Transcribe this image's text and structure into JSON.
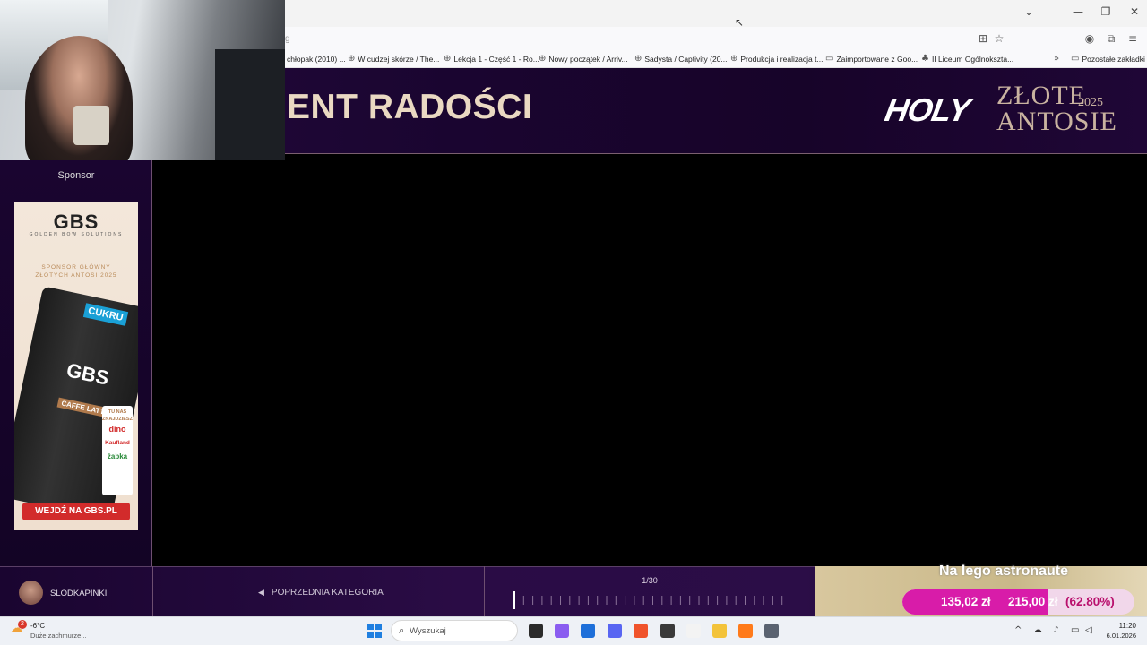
{
  "browser": {
    "window_controls": {
      "chevron": "⌄",
      "minimize": "—",
      "restore": "❐",
      "close": "✕"
    },
    "url_fragment": "g",
    "bookmarks": [
      {
        "label": "chłopak (2010) ...",
        "icon": "globe-icon"
      },
      {
        "label": "W cudzej skórze / The...",
        "icon": "globe-icon"
      },
      {
        "label": "Lekcja 1 - Część 1 - Ro...",
        "icon": "globe-icon"
      },
      {
        "label": "Nowy początek / Arriv...",
        "icon": "globe-icon"
      },
      {
        "label": "Sadysta / Captivity (20...",
        "icon": "globe-icon"
      },
      {
        "label": "Produkcja i realizacja t...",
        "icon": "globe-icon"
      },
      {
        "label": "Zaimportowane z Goo...",
        "icon": "folder-icon"
      },
      {
        "label": "II Liceum Ogólnokszta...",
        "icon": "school-icon"
      }
    ],
    "other_bookmarks": "Pozostałe zakładki"
  },
  "header": {
    "title": "ENT RADOŚCI",
    "logo_holy": "HOLY",
    "logo_zlote": "ZŁOTE",
    "logo_year": "2025",
    "logo_antosie": "ANTOSIE"
  },
  "sidebar": {
    "sponsor_label": "Sponsor",
    "ad": {
      "brand": "GBS",
      "brand_sub": "GOLDEN BOW SOLUTIONS",
      "sponsor_line1": "SPONSOR GŁÓWNY",
      "sponsor_line2": "ZŁOTYCH ANTOSI 2025",
      "can_brand": "GBS",
      "can_tag": "CUKRU",
      "can_flavor": "CAFFE LATTE",
      "stores": [
        "TU NAS ZNAJDZIESZ",
        "dino",
        "Kaufland",
        "żabka"
      ],
      "cta": "WEJDŹ NA GBS.PL"
    }
  },
  "bottom_bar": {
    "user_name": "SLODKAPINKI",
    "prev_category": "POPRZEDNIA KATEGORIA",
    "page_count": "1/30",
    "progress_position": 1,
    "progress_total": 30,
    "vote": {
      "title": "Na lego astronaute",
      "current": "135,02 zł",
      "goal": "215,00 zł",
      "percent_label": "(62.80%)",
      "percent": 62.8
    }
  },
  "taskbar": {
    "temperature": "-6°C",
    "weather_desc": "Duże zachmurze...",
    "weather_badge": "2",
    "search_placeholder": "Wyszukaj",
    "time": "11:20",
    "date": "6.01.2026",
    "apps": [
      {
        "name": "terminal-icon",
        "color": "#2b2b2b"
      },
      {
        "name": "copilot-icon",
        "color": "#8a5cf0"
      },
      {
        "name": "store-icon",
        "color": "#1e6fd9"
      },
      {
        "name": "discord-icon",
        "color": "#5865f2"
      },
      {
        "name": "brave-icon",
        "color": "#f0532b"
      },
      {
        "name": "obs-icon",
        "color": "#3a3a3a"
      },
      {
        "name": "notes-icon",
        "color": "#f3f3f3"
      },
      {
        "name": "explorer-icon",
        "color": "#f3c33a"
      },
      {
        "name": "firefox-icon",
        "color": "#ff7a1a"
      },
      {
        "name": "settings-icon",
        "color": "#5a6270"
      }
    ]
  },
  "colors": {
    "header_bg": "#1a0530",
    "title_color": "#ead9c2",
    "vote_fill": "#d81ca9",
    "vote_pct": "#b9106d",
    "ad_cta": "#d22b2b"
  }
}
